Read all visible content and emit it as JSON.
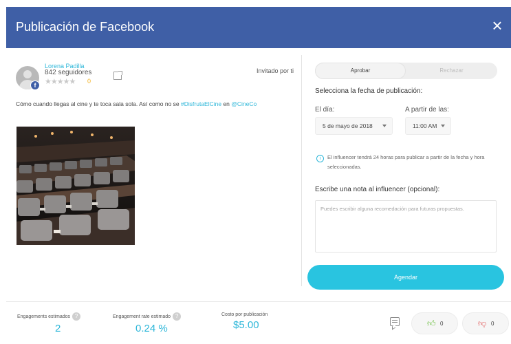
{
  "window": {
    "title": "Publicación de Facebook"
  },
  "profile": {
    "name": "Lorena Padilla",
    "followers": "842 seguidores",
    "stars": "★★★★★",
    "rating_count": "0",
    "invited": "Invitado por ti"
  },
  "post": {
    "text_before": "Cómo cuando llegas al cine y te toca sala sola. Así como no se ",
    "hashtag": "#DisfrutaElCine",
    "text_middle": " en ",
    "mention": "@CineCo"
  },
  "toggle": {
    "approve": "Aprobar",
    "reject": "Rechazar"
  },
  "schedule": {
    "title": "Selecciona la fecha de publicación:",
    "day_label": "El día:",
    "day_value": "5 de mayo de 2018",
    "time_label": "A partir de las:",
    "time_value": "11:00 AM",
    "info": "El influencer tendrá 24 horas para publicar a partir de la fecha y hora seleccionadas."
  },
  "note": {
    "label": "Escribe una nota al influencer (opcional):",
    "placeholder": "Puedes escribir alguna recomedación para futuras propuestas."
  },
  "buttons": {
    "schedule": "Agendar",
    "close": "×"
  },
  "metrics": [
    {
      "label": "Engagements estimados",
      "value": "2"
    },
    {
      "label": "Engagement rate estimado",
      "value": "0.24 %"
    },
    {
      "label": "Costo por publicación",
      "value": "$5.00"
    }
  ],
  "feedback": {
    "likes": "0",
    "dislikes": "0"
  },
  "colors": {
    "header": "#3f5fa6",
    "accent": "#2eb7d9",
    "button": "#29c4e0"
  }
}
